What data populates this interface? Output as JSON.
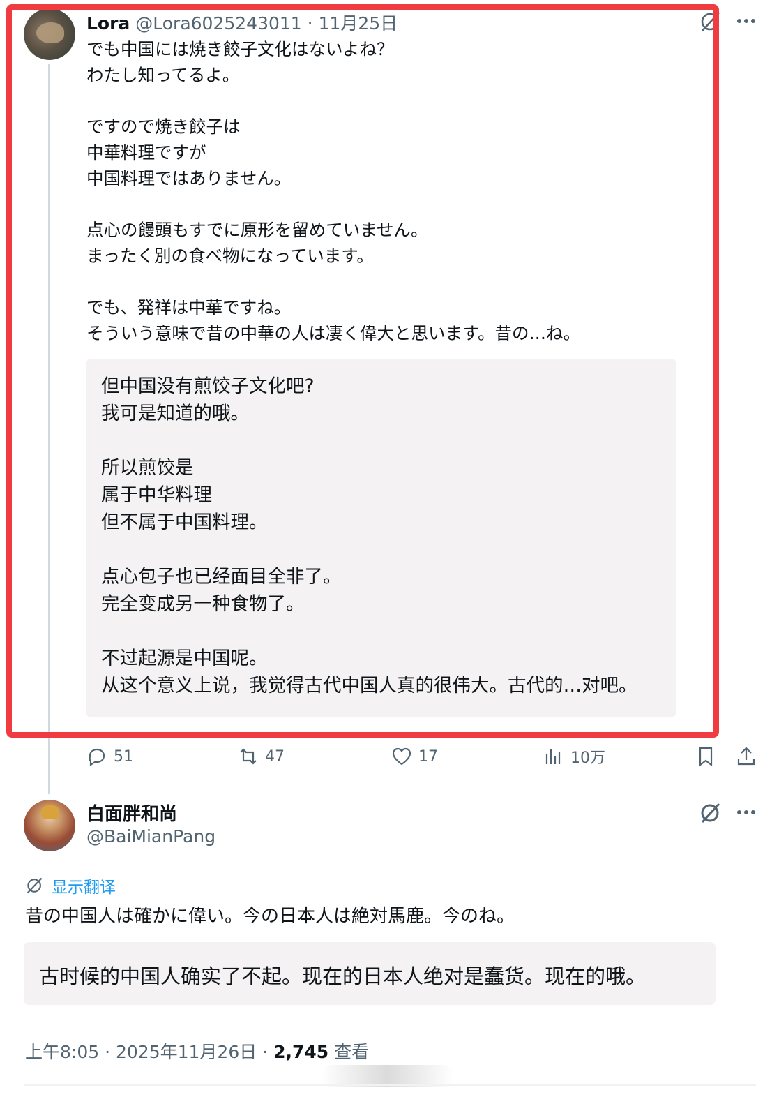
{
  "tweet1": {
    "name": "Lora",
    "handle": "@Lora6025243011",
    "sep": " · ",
    "date": "11月25日",
    "text_paragraphs": [
      [
        "でも中国には焼き餃子文化はないよね？",
        "わたし知ってるよ。"
      ],
      [
        "ですので焼き餃子は",
        "中華料理ですが",
        "中国料理ではありません。"
      ],
      [
        "点心の饅頭もすでに原形を留めていません。",
        "まったく別の食べ物になっています。"
      ],
      [
        "でも、発祥は中華ですね。",
        "そういう意味で昔の中華の人は凄く偉大と思います。昔の…ね。"
      ]
    ],
    "translation_paragraphs": [
      [
        "但中国没有煎饺子文化吧?",
        "我可是知道的哦。"
      ],
      [
        "所以煎饺是",
        "属于中华料理",
        "但不属于中国料理。"
      ],
      [
        "点心包子也已经面目全非了。",
        "完全变成另一种食物了。"
      ],
      [
        "不过起源是中国呢。",
        "从这个意义上说，我觉得古代中国人真的很伟大。古代的…对吧。"
      ]
    ],
    "actions": {
      "replies": "51",
      "retweets": "47",
      "likes": "17",
      "views": "10万"
    }
  },
  "tweet2": {
    "name": "白面胖和尚",
    "handle": "@BaiMianPang",
    "show_translation": "显示翻译",
    "text": "昔の中国人は確かに偉い。今の日本人は絶対馬鹿。今のね。",
    "translation": "古时候的中国人确实了不起。现在的日本人绝对是蠢货。现在的哦。",
    "time": "上午8:05",
    "date": "2025年11月26日",
    "views_count": "2,745",
    "views_label": "查看"
  },
  "icons": [
    "grok-icon",
    "more-icon",
    "reply-icon",
    "retweet-icon",
    "like-icon",
    "views-icon",
    "bookmark-icon",
    "share-icon"
  ],
  "colors": {
    "highlight_frame": "#f03c40",
    "link": "#1d9bf0",
    "secondary_text": "#536471",
    "translation_bg": "#f4f2f2"
  }
}
